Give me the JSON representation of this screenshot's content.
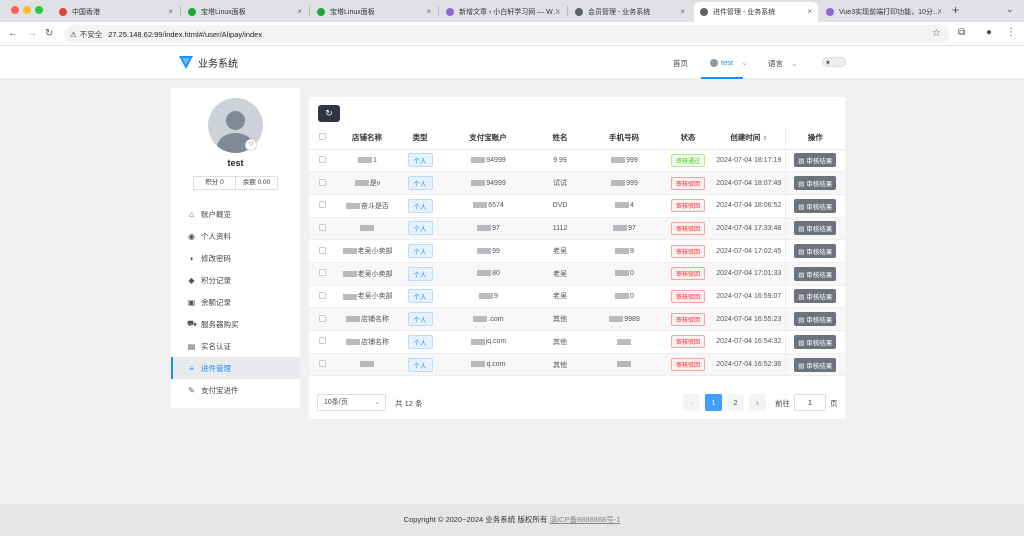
{
  "browser": {
    "tabs": [
      {
        "title": "中国香港",
        "color": "#e0433a"
      },
      {
        "title": "宝塔Linux面板",
        "color": "#20a53a"
      },
      {
        "title": "宝塔Linux面板",
        "color": "#20a53a"
      },
      {
        "title": "新增文章 ‹ 小白轩学习网 — W…",
        "color": "#8a6bd1"
      },
      {
        "title": "会员管理 - 业务系统",
        "color": "#5f6368"
      },
      {
        "title": "进件管理 - 业务系统",
        "color": "#5f6368"
      },
      {
        "title": "Vue3实现前端打印功能，10分…",
        "color": "#8a6bd1"
      }
    ],
    "insecure_label": "不安全",
    "url": "27.25.148.62:99/index.html#/user/Alipay/index"
  },
  "header": {
    "app_title": "业务系统",
    "nav_home": "首页",
    "nav_user": "test",
    "nav_lang": "语言"
  },
  "sidebar": {
    "username": "test",
    "points": "积分 0",
    "balance": "余额 0.00",
    "items": [
      {
        "label": "账户概览",
        "icon": "home-icon",
        "glyph": "⌂"
      },
      {
        "label": "个人资料",
        "icon": "user-circle-icon",
        "glyph": "◉"
      },
      {
        "label": "修改密码",
        "icon": "shield-icon",
        "glyph": "◖"
      },
      {
        "label": "积分记录",
        "icon": "tag-icon",
        "glyph": "◆"
      },
      {
        "label": "余额记录",
        "icon": "money-icon",
        "glyph": "▣"
      },
      {
        "label": "服务器购买",
        "icon": "cart-icon",
        "glyph": "⛟"
      },
      {
        "label": "实名认证",
        "icon": "id-card-icon",
        "glyph": "▤"
      },
      {
        "label": "进件管理",
        "icon": "list-icon",
        "glyph": "≡"
      },
      {
        "label": "支付宝进件",
        "icon": "edit-icon",
        "glyph": "✎"
      }
    ]
  },
  "table": {
    "headers": [
      "店铺名称",
      "类型",
      "支付宝账户",
      "姓名",
      "手机号码",
      "状态",
      "创建时间",
      "操作"
    ],
    "op_label": "审核结果",
    "rows": [
      {
        "shop": "1",
        "type": "个人",
        "account": "94999",
        "name": "9 99",
        "phone": "999",
        "status": "审核通过",
        "ok": true,
        "time": "2024-07-04 18:17:19"
      },
      {
        "shop": "是v",
        "type": "个人",
        "account": "94999",
        "name": "试试",
        "phone": "999",
        "status": "审核驳回",
        "ok": false,
        "time": "2024-07-04 18:07:49"
      },
      {
        "shop": "奋斗是否",
        "type": "个人",
        "account": "6574",
        "name": "DVD",
        "phone": "4",
        "status": "审核驳回",
        "ok": false,
        "time": "2024-07-04 18:06:52"
      },
      {
        "shop": "",
        "type": "个人",
        "account": "97",
        "name": "1112",
        "phone": "97",
        "status": "审核驳回",
        "ok": false,
        "time": "2024-07-04 17:33:48"
      },
      {
        "shop": "老吴小卖部",
        "type": "个人",
        "account": "99",
        "name": "老吴",
        "phone": "9",
        "status": "审核驳回",
        "ok": false,
        "time": "2024-07-04 17:02:45"
      },
      {
        "shop": "老吴小卖部",
        "type": "个人",
        "account": "80",
        "name": "老吴",
        "phone": "0",
        "status": "审核驳回",
        "ok": false,
        "time": "2024-07-04 17:01:33"
      },
      {
        "shop": "老吴小卖部",
        "type": "个人",
        "account": "9",
        "name": "老吴",
        "phone": "0",
        "status": "审核驳回",
        "ok": false,
        "time": "2024-07-04 16:59:07"
      },
      {
        "shop": "店铺名称",
        "type": "个人",
        "account": ".com",
        "name": "其他",
        "phone": "9989",
        "status": "审核驳回",
        "ok": false,
        "time": "2024-07-04 16:55:23"
      },
      {
        "shop": "店铺名称",
        "type": "个人",
        "account": "jq.com",
        "name": "其他",
        "phone": "",
        "status": "审核驳回",
        "ok": false,
        "time": "2024-07-04 16:54:32"
      },
      {
        "shop": "",
        "type": "个人",
        "account": "q.com",
        "name": "其他",
        "phone": "",
        "status": "审核驳回",
        "ok": false,
        "time": "2024-07-04 16:52:36"
      }
    ]
  },
  "pagination": {
    "page_size": "10条/页",
    "total": "共 12 条",
    "pages": [
      "1",
      "2"
    ],
    "goto_label": "前往",
    "goto_value": "1",
    "goto_suffix": "页"
  },
  "footer": {
    "copyright": "Copyright © 2020~2024 业务系统 版权所有",
    "icp": "滇ICP备8888888号-1"
  }
}
